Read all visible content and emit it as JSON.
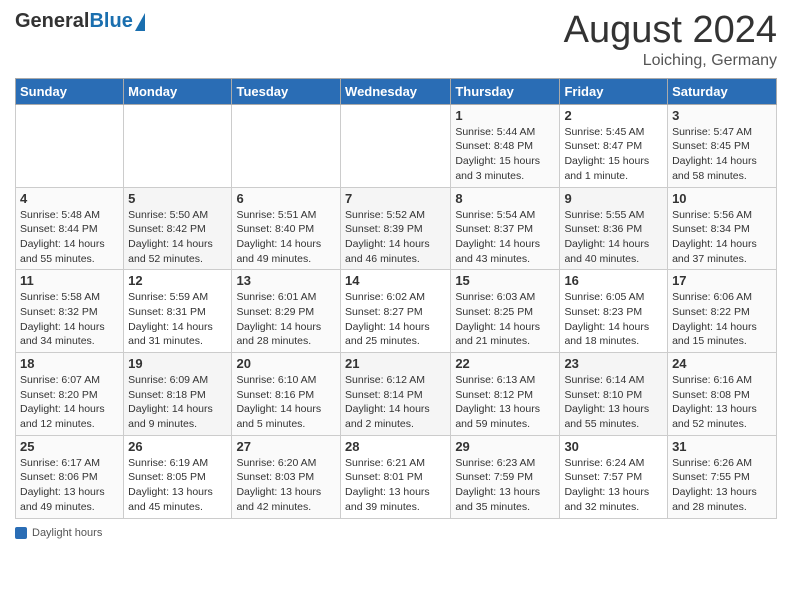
{
  "header": {
    "logo_general": "General",
    "logo_blue": "Blue",
    "month_year": "August 2024",
    "location": "Loiching, Germany"
  },
  "footer": {
    "label": "Daylight hours"
  },
  "days_of_week": [
    "Sunday",
    "Monday",
    "Tuesday",
    "Wednesday",
    "Thursday",
    "Friday",
    "Saturday"
  ],
  "weeks": [
    [
      {
        "num": "",
        "info": ""
      },
      {
        "num": "",
        "info": ""
      },
      {
        "num": "",
        "info": ""
      },
      {
        "num": "",
        "info": ""
      },
      {
        "num": "1",
        "info": "Sunrise: 5:44 AM\nSunset: 8:48 PM\nDaylight: 15 hours\nand 3 minutes."
      },
      {
        "num": "2",
        "info": "Sunrise: 5:45 AM\nSunset: 8:47 PM\nDaylight: 15 hours\nand 1 minute."
      },
      {
        "num": "3",
        "info": "Sunrise: 5:47 AM\nSunset: 8:45 PM\nDaylight: 14 hours\nand 58 minutes."
      }
    ],
    [
      {
        "num": "4",
        "info": "Sunrise: 5:48 AM\nSunset: 8:44 PM\nDaylight: 14 hours\nand 55 minutes."
      },
      {
        "num": "5",
        "info": "Sunrise: 5:50 AM\nSunset: 8:42 PM\nDaylight: 14 hours\nand 52 minutes."
      },
      {
        "num": "6",
        "info": "Sunrise: 5:51 AM\nSunset: 8:40 PM\nDaylight: 14 hours\nand 49 minutes."
      },
      {
        "num": "7",
        "info": "Sunrise: 5:52 AM\nSunset: 8:39 PM\nDaylight: 14 hours\nand 46 minutes."
      },
      {
        "num": "8",
        "info": "Sunrise: 5:54 AM\nSunset: 8:37 PM\nDaylight: 14 hours\nand 43 minutes."
      },
      {
        "num": "9",
        "info": "Sunrise: 5:55 AM\nSunset: 8:36 PM\nDaylight: 14 hours\nand 40 minutes."
      },
      {
        "num": "10",
        "info": "Sunrise: 5:56 AM\nSunset: 8:34 PM\nDaylight: 14 hours\nand 37 minutes."
      }
    ],
    [
      {
        "num": "11",
        "info": "Sunrise: 5:58 AM\nSunset: 8:32 PM\nDaylight: 14 hours\nand 34 minutes."
      },
      {
        "num": "12",
        "info": "Sunrise: 5:59 AM\nSunset: 8:31 PM\nDaylight: 14 hours\nand 31 minutes."
      },
      {
        "num": "13",
        "info": "Sunrise: 6:01 AM\nSunset: 8:29 PM\nDaylight: 14 hours\nand 28 minutes."
      },
      {
        "num": "14",
        "info": "Sunrise: 6:02 AM\nSunset: 8:27 PM\nDaylight: 14 hours\nand 25 minutes."
      },
      {
        "num": "15",
        "info": "Sunrise: 6:03 AM\nSunset: 8:25 PM\nDaylight: 14 hours\nand 21 minutes."
      },
      {
        "num": "16",
        "info": "Sunrise: 6:05 AM\nSunset: 8:23 PM\nDaylight: 14 hours\nand 18 minutes."
      },
      {
        "num": "17",
        "info": "Sunrise: 6:06 AM\nSunset: 8:22 PM\nDaylight: 14 hours\nand 15 minutes."
      }
    ],
    [
      {
        "num": "18",
        "info": "Sunrise: 6:07 AM\nSunset: 8:20 PM\nDaylight: 14 hours\nand 12 minutes."
      },
      {
        "num": "19",
        "info": "Sunrise: 6:09 AM\nSunset: 8:18 PM\nDaylight: 14 hours\nand 9 minutes."
      },
      {
        "num": "20",
        "info": "Sunrise: 6:10 AM\nSunset: 8:16 PM\nDaylight: 14 hours\nand 5 minutes."
      },
      {
        "num": "21",
        "info": "Sunrise: 6:12 AM\nSunset: 8:14 PM\nDaylight: 14 hours\nand 2 minutes."
      },
      {
        "num": "22",
        "info": "Sunrise: 6:13 AM\nSunset: 8:12 PM\nDaylight: 13 hours\nand 59 minutes."
      },
      {
        "num": "23",
        "info": "Sunrise: 6:14 AM\nSunset: 8:10 PM\nDaylight: 13 hours\nand 55 minutes."
      },
      {
        "num": "24",
        "info": "Sunrise: 6:16 AM\nSunset: 8:08 PM\nDaylight: 13 hours\nand 52 minutes."
      }
    ],
    [
      {
        "num": "25",
        "info": "Sunrise: 6:17 AM\nSunset: 8:06 PM\nDaylight: 13 hours\nand 49 minutes."
      },
      {
        "num": "26",
        "info": "Sunrise: 6:19 AM\nSunset: 8:05 PM\nDaylight: 13 hours\nand 45 minutes."
      },
      {
        "num": "27",
        "info": "Sunrise: 6:20 AM\nSunset: 8:03 PM\nDaylight: 13 hours\nand 42 minutes."
      },
      {
        "num": "28",
        "info": "Sunrise: 6:21 AM\nSunset: 8:01 PM\nDaylight: 13 hours\nand 39 minutes."
      },
      {
        "num": "29",
        "info": "Sunrise: 6:23 AM\nSunset: 7:59 PM\nDaylight: 13 hours\nand 35 minutes."
      },
      {
        "num": "30",
        "info": "Sunrise: 6:24 AM\nSunset: 7:57 PM\nDaylight: 13 hours\nand 32 minutes."
      },
      {
        "num": "31",
        "info": "Sunrise: 6:26 AM\nSunset: 7:55 PM\nDaylight: 13 hours\nand 28 minutes."
      }
    ]
  ]
}
